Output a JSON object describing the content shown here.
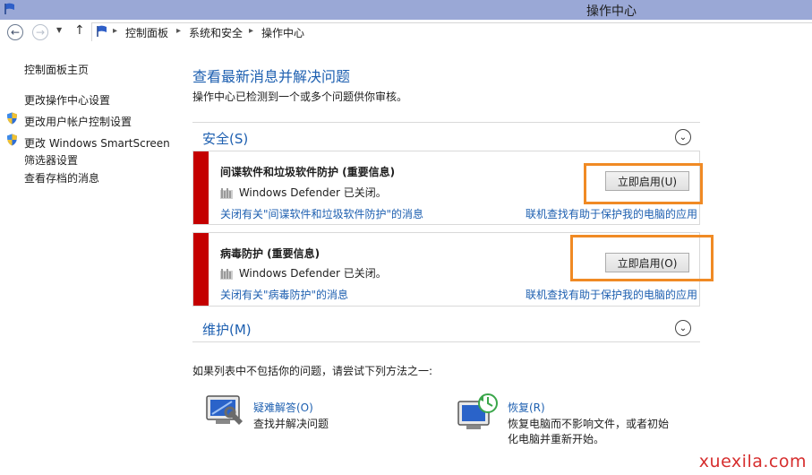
{
  "window": {
    "title": "操作中心"
  },
  "breadcrumb": [
    "控制面板",
    "系统和安全",
    "操作中心"
  ],
  "sidebar": {
    "items": [
      {
        "label": "控制面板主页"
      },
      {
        "label": "更改操作中心设置"
      },
      {
        "label": "更改用户帐户控制设置"
      },
      {
        "label": "更改 Windows SmartScreen"
      },
      {
        "label": "筛选器设置"
      },
      {
        "label": "查看存档的消息"
      }
    ]
  },
  "main": {
    "heading": "查看最新消息并解决问题",
    "subheading": "操作中心已检测到一个或多个问题供你审核。",
    "security": {
      "title": "安全(S)",
      "panels": [
        {
          "title": "间谍软件和垃圾软件防护 (重要信息)",
          "status": "Windows Defender 已关闭。",
          "button": "立即启用(U)",
          "left_link": "关闭有关\"间谍软件和垃圾软件防护\"的消息",
          "right_link": "联机查找有助于保护我的电脑的应用"
        },
        {
          "title": "病毒防护 (重要信息)",
          "status": "Windows Defender 已关闭。",
          "button": "立即启用(O)",
          "left_link": "关闭有关\"病毒防护\"的消息",
          "right_link": "联机查找有助于保护我的电脑的应用"
        }
      ]
    },
    "maintenance": {
      "title": "维护(M)"
    },
    "hint": "如果列表中不包括你的问题，请尝试下列方法之一:",
    "tools": [
      {
        "title": "疑难解答(O)",
        "desc": [
          "查找并解决问题"
        ]
      },
      {
        "title": "恢复(R)",
        "desc": [
          "恢复电脑而不影响文件，或者初始",
          "化电脑并重新开始。"
        ]
      }
    ]
  },
  "watermark": "xuexila.com",
  "colors": {
    "titlebar": "#9aa8d6",
    "link": "#1d5fb0",
    "alert_red": "#c40000",
    "highlight": "#f08a24"
  }
}
